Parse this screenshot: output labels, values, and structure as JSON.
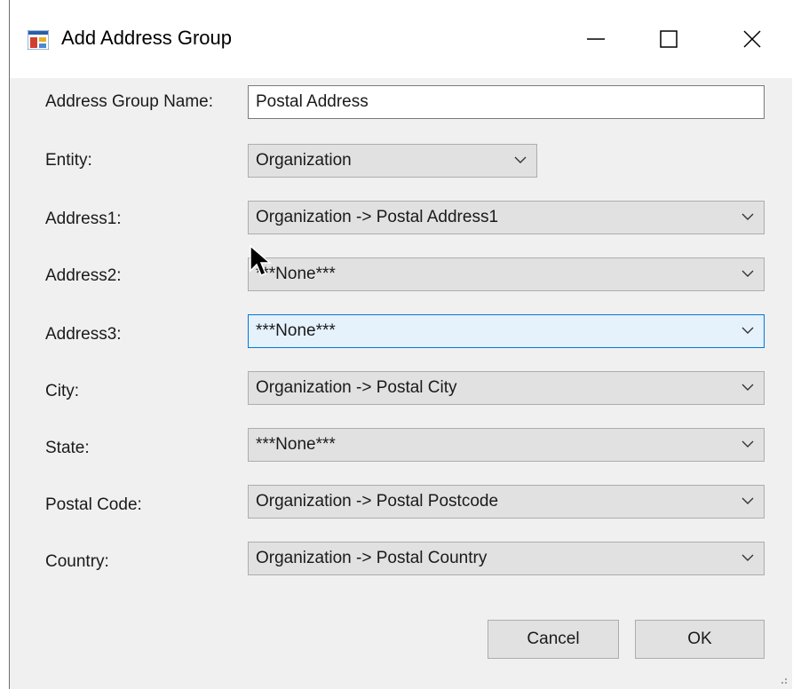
{
  "window": {
    "title": "Add Address Group",
    "controls": {
      "minimize": "minimize",
      "maximize": "maximize",
      "close": "close"
    }
  },
  "form": {
    "group_name": {
      "label": "Address Group Name:",
      "value": "Postal Address"
    },
    "fields": [
      {
        "label": "Entity:",
        "value": "Organization"
      },
      {
        "label": "Address1:",
        "value": "Organization -> Postal Address1"
      },
      {
        "label": "Address2:",
        "value": "***None***"
      },
      {
        "label": "Address3:",
        "value": "***None***"
      },
      {
        "label": "City:",
        "value": "Organization -> Postal City"
      },
      {
        "label": "State:",
        "value": "***None***"
      },
      {
        "label": "Postal Code:",
        "value": "Organization -> Postal Postcode"
      },
      {
        "label": "Country:",
        "value": "Organization -> Postal Country"
      }
    ]
  },
  "buttons": {
    "cancel": "Cancel",
    "ok": "OK"
  },
  "colors": {
    "focus_border": "#0078d7",
    "focus_fill": "#e5f1fb",
    "combo_fill": "#e1e1e1"
  }
}
